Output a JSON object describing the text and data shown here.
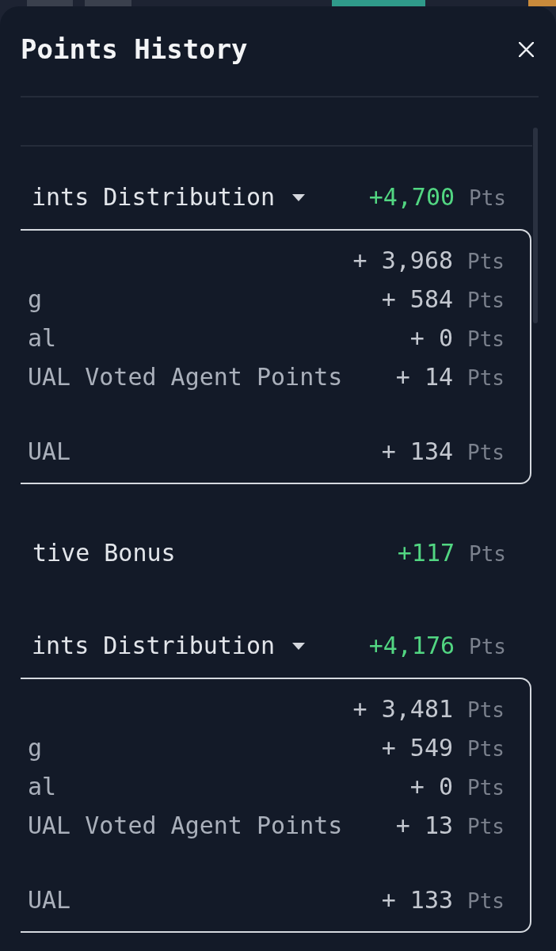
{
  "title": "Points History",
  "sections": [
    {
      "kind": "distribution",
      "label": "ints Distribution",
      "expanded": true,
      "total": "+4,700",
      "unit": "Pts",
      "items": [
        {
          "kind": "line",
          "value": "+ 3,968",
          "unit": "Pts"
        },
        {
          "kind": "line",
          "label": "g",
          "value": "+ 584",
          "unit": "Pts"
        },
        {
          "kind": "line",
          "label": "al",
          "value": "+ 0",
          "unit": "Pts"
        },
        {
          "kind": "wrapped",
          "label": "UAL Voted Agent Points",
          "value": "+ 14",
          "unit": "Pts"
        },
        {
          "kind": "line",
          "label": "UAL",
          "value": "+ 134",
          "unit": "Pts"
        }
      ]
    },
    {
      "kind": "bonus",
      "label": "tive Bonus",
      "total": "+117",
      "unit": "Pts"
    },
    {
      "kind": "distribution",
      "label": "ints Distribution",
      "expanded": true,
      "total": "+4,176",
      "unit": "Pts",
      "items": [
        {
          "kind": "line",
          "value": "+ 3,481",
          "unit": "Pts"
        },
        {
          "kind": "line",
          "label": "g",
          "value": "+ 549",
          "unit": "Pts"
        },
        {
          "kind": "line",
          "label": "al",
          "value": "+ 0",
          "unit": "Pts"
        },
        {
          "kind": "wrapped",
          "label": "UAL Voted Agent Points",
          "value": "+ 13",
          "unit": "Pts"
        },
        {
          "kind": "line",
          "label": "UAL",
          "value": "+ 133",
          "unit": "Pts"
        }
      ]
    }
  ]
}
